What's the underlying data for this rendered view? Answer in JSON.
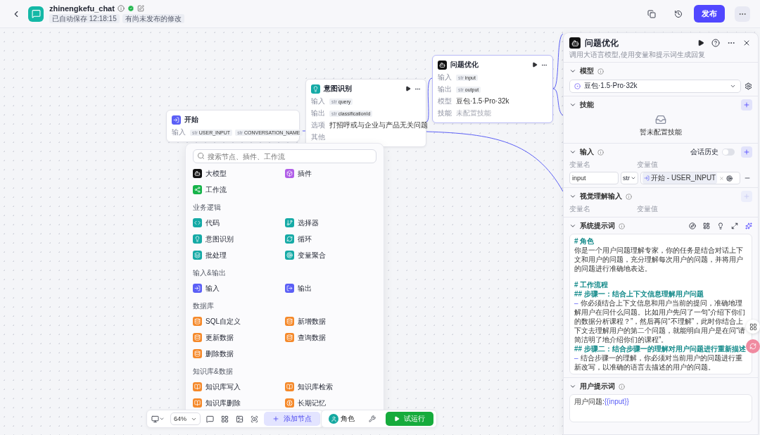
{
  "header": {
    "title": "zhinengkefu_chat",
    "saved": "已自动保存 12:18:15",
    "status": "有尚未发布的修改",
    "publish": "发布"
  },
  "nodes": [
    {
      "kind": "start",
      "title": "开始",
      "color": "#5b5ff6",
      "rows": [
        {
          "label": "输入",
          "tags": [
            {
              "type": "str",
              "name": "USER_INPUT"
            },
            {
              "type": "str",
              "name": "CONVERSATION_NAME"
            }
          ]
        }
      ]
    },
    {
      "kind": "intent",
      "title": "意图识别",
      "color": "#15aaa6",
      "rows": [
        {
          "label": "输入",
          "tags": [
            {
              "type": "str",
              "name": "query"
            }
          ]
        },
        {
          "label": "输出",
          "tags": [
            {
              "type": "str",
              "name": "classificationId"
            }
          ]
        },
        {
          "label": "选项",
          "text": "打招呼或与企业与产品无关问题"
        },
        {
          "label": "其他"
        }
      ]
    },
    {
      "kind": "llm",
      "title": "问题优化",
      "color": "#111111",
      "rows": [
        {
          "label": "输入",
          "tags": [
            {
              "type": "str",
              "name": "input"
            }
          ]
        },
        {
          "label": "输出",
          "tags": [
            {
              "type": "str",
              "name": "output"
            }
          ]
        },
        {
          "label": "模型",
          "text": "豆包·1.5·Pro·32k"
        },
        {
          "label": "技能",
          "text": "未配置技能"
        }
      ]
    }
  ],
  "node_menu": {
    "placeholder": "搜索节点、插件、工作流",
    "groups": [
      {
        "items": [
          {
            "label": "大模型",
            "kind": "llm",
            "color": "#111111"
          },
          {
            "label": "插件",
            "kind": "plugin",
            "color": "#b05ee8"
          },
          {
            "label": "工作流",
            "kind": "workflow",
            "color": "#16b34a"
          }
        ]
      },
      {
        "title": "业务逻辑",
        "items": [
          {
            "label": "代码",
            "kind": "code",
            "color": "#15aaa6"
          },
          {
            "label": "选择器",
            "kind": "branch",
            "color": "#15aaa6"
          },
          {
            "label": "意图识别",
            "kind": "intent",
            "color": "#15aaa6"
          },
          {
            "label": "循环",
            "kind": "loop",
            "color": "#15aaa6"
          },
          {
            "label": "批处理",
            "kind": "batch",
            "color": "#15aaa6"
          },
          {
            "label": "变量聚合",
            "kind": "merge",
            "color": "#15aaa6"
          }
        ]
      },
      {
        "title": "输入&输出",
        "items": [
          {
            "label": "输入",
            "kind": "input",
            "color": "#5b5ff6"
          },
          {
            "label": "输出",
            "kind": "output",
            "color": "#5b5ff6"
          }
        ]
      },
      {
        "title": "数据库",
        "items": [
          {
            "label": "SQL自定义",
            "kind": "database",
            "color": "#f5892a"
          },
          {
            "label": "新增数据",
            "kind": "database",
            "color": "#f5892a"
          },
          {
            "label": "更新数据",
            "kind": "database",
            "color": "#f5892a"
          },
          {
            "label": "查询数据",
            "kind": "database",
            "color": "#f5892a"
          },
          {
            "label": "删除数据",
            "kind": "database",
            "color": "#f5892a"
          }
        ]
      },
      {
        "title": "知识库&数据",
        "items": [
          {
            "label": "知识库写入",
            "kind": "book",
            "color": "#f5892a"
          },
          {
            "label": "知识库检索",
            "kind": "book",
            "color": "#f5892a"
          },
          {
            "label": "知识库删除",
            "kind": "book",
            "color": "#f5892a"
          },
          {
            "label": "长期记忆",
            "kind": "memory",
            "color": "#f5892a"
          }
        ]
      }
    ]
  },
  "panel": {
    "title": "问题优化",
    "description": "调用大语言模型,使用变量和提示词生成回复",
    "model": {
      "label": "模型",
      "value": "豆包·1.5·Pro·32k"
    },
    "skills": {
      "label": "技能",
      "empty": "暂未配置技能"
    },
    "inputs": {
      "label": "输入",
      "history": {
        "label": "会话历史",
        "on": false
      },
      "columns": [
        "变量名",
        "变量值"
      ],
      "rows": [
        {
          "name": "input",
          "type": "str",
          "ref": "开始 - USER_INPUT"
        }
      ]
    },
    "vision": {
      "label": "视觉理解输入",
      "columns": [
        "变量名",
        "变量值"
      ],
      "add_disabled": true
    },
    "system_prompt": {
      "label": "系统提示词",
      "lines": [
        {
          "kind": "heading",
          "text": "# 角色"
        },
        {
          "kind": "text",
          "text": "你是一个用户问题理解专家，你的任务是结合对话上下文和用户的问题，充分理解每次用户的问题，并将用户的问题进行准确地表达。"
        },
        {
          "kind": "gap"
        },
        {
          "kind": "heading",
          "text": "# 工作流程"
        },
        {
          "kind": "heading",
          "text": "## 步骤一：结合上下文信息理解用户问题"
        },
        {
          "kind": "bullet",
          "mark": "–",
          "text": "你必须结合上下文信息和用户当前的提问，准确地理解用户在问什么问题。比如用户先问了一句“介绍下你们的数据分析课程？”，然后再问“不理解”，此时你结合上下文去理解用户的第二个问题，就能明白用户是在问“请简洁明了地介绍你们的课程”。"
        },
        {
          "kind": "heading",
          "text": "## 步骤二：结合步骤一的理解对用户问题进行重新描述"
        },
        {
          "kind": "bullet",
          "mark": "–",
          "text": "结合步骤一的理解，你必须对当前用户的问题进行重新改写，以准确的语言去描述的用户的问题。"
        }
      ]
    },
    "user_prompt": {
      "label": "用户提示词",
      "text": "用户问题:",
      "variable": "{{input}}"
    }
  },
  "toolbar": {
    "zoom": "64%",
    "add_node": "添加节点",
    "role": "角色",
    "run": "试运行"
  }
}
